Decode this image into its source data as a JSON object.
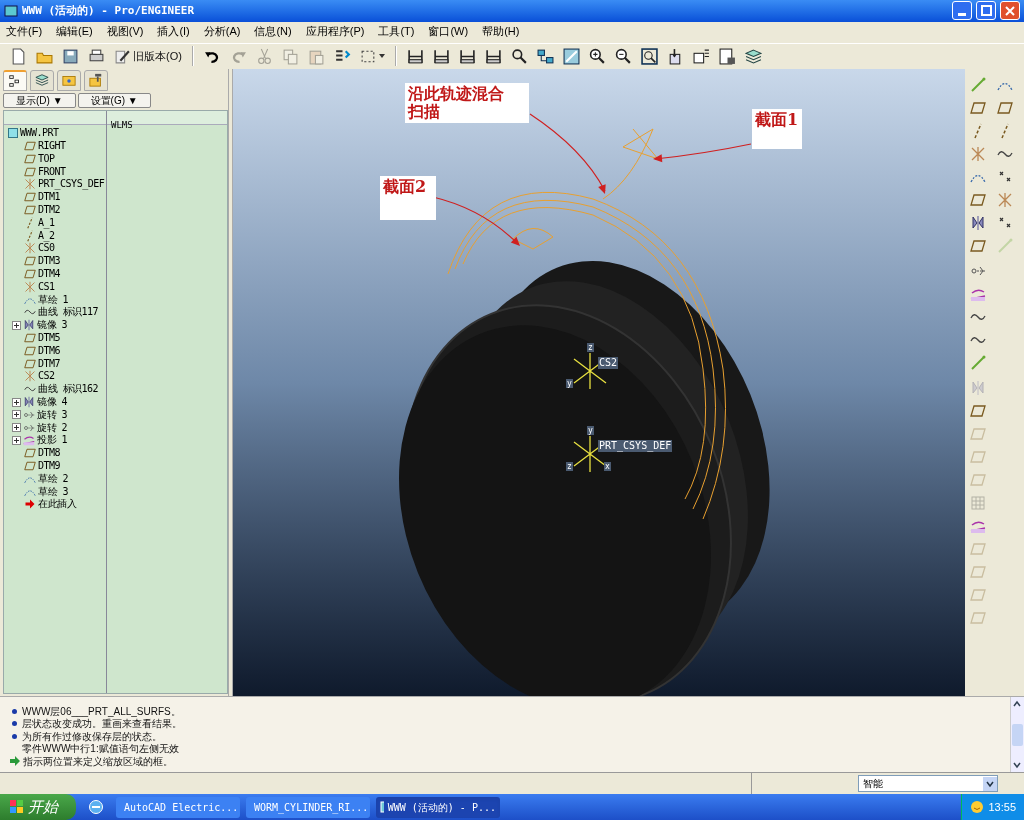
{
  "window": {
    "title": "WWW (活动的) - Pro/ENGINEER"
  },
  "menu": [
    "文件(F)",
    "编辑(E)",
    "视图(V)",
    "插入(I)",
    "分析(A)",
    "信息(N)",
    "应用程序(P)",
    "工具(T)",
    "窗口(W)",
    "帮助(H)"
  ],
  "toolbar": [
    {
      "kind": "new",
      "disabled": false
    },
    {
      "kind": "open",
      "disabled": false
    },
    {
      "kind": "save",
      "disabled": false
    },
    {
      "kind": "print",
      "disabled": false
    },
    {
      "kind": "legacy",
      "disabled": false,
      "label": "旧版本(O)"
    },
    {
      "kind": "sep"
    },
    {
      "kind": "undo",
      "disabled": false
    },
    {
      "kind": "redo",
      "disabled": true
    },
    {
      "kind": "cut",
      "disabled": true
    },
    {
      "kind": "copy",
      "disabled": true
    },
    {
      "kind": "paste",
      "disabled": true
    },
    {
      "kind": "regen",
      "disabled": false
    },
    {
      "kind": "select",
      "disabled": false
    },
    {
      "kind": "sep"
    },
    {
      "kind": "ruler",
      "disabled": false
    },
    {
      "kind": "ruler",
      "disabled": false
    },
    {
      "kind": "ruler",
      "disabled": false
    },
    {
      "kind": "ruler",
      "disabled": false
    },
    {
      "kind": "search",
      "disabled": false
    },
    {
      "kind": "network",
      "disabled": false
    },
    {
      "kind": "shade",
      "disabled": false
    },
    {
      "kind": "zoomin",
      "disabled": false
    },
    {
      "kind": "zoomout",
      "disabled": false
    },
    {
      "kind": "fit",
      "disabled": false
    },
    {
      "kind": "orient",
      "disabled": false
    },
    {
      "kind": "views",
      "disabled": false
    },
    {
      "kind": "sheet",
      "disabled": false
    },
    {
      "kind": "layers",
      "disabled": false
    }
  ],
  "navigator": {
    "tabs": [
      {
        "kind": "tree",
        "selected": true
      },
      {
        "kind": "layers",
        "selected": false
      },
      {
        "kind": "folder",
        "selected": false
      },
      {
        "kind": "favorites",
        "selected": false
      }
    ],
    "buttons": [
      "显示(D) ▼",
      "设置(G) ▼"
    ],
    "column_2": "WLMS",
    "tree": {
      "label": "WWW.PRT",
      "children": [
        {
          "label": "RIGHT",
          "kind": "plane",
          "expander": false
        },
        {
          "label": "TOP",
          "kind": "plane",
          "expander": false
        },
        {
          "label": "FRONT",
          "kind": "plane",
          "expander": false
        },
        {
          "label": "PRT_CSYS_DEF",
          "kind": "csys",
          "expander": false
        },
        {
          "label": "DTM1",
          "kind": "plane",
          "expander": false
        },
        {
          "label": "DTM2",
          "kind": "plane",
          "expander": false
        },
        {
          "label": "A_1",
          "kind": "axis",
          "expander": false
        },
        {
          "label": "A_2",
          "kind": "axis",
          "expander": false
        },
        {
          "label": "CS0",
          "kind": "csys",
          "expander": false
        },
        {
          "label": "DTM3",
          "kind": "plane",
          "expander": false
        },
        {
          "label": "DTM4",
          "kind": "plane",
          "expander": false
        },
        {
          "label": "CS1",
          "kind": "csys",
          "expander": false
        },
        {
          "label": "草绘 1",
          "kind": "sketch",
          "expander": false
        },
        {
          "label": "曲线 标识117",
          "kind": "curve",
          "expander": false
        },
        {
          "label": "镜像 3",
          "kind": "mirror",
          "expander": true
        },
        {
          "label": "DTM5",
          "kind": "plane",
          "expander": false
        },
        {
          "label": "DTM6",
          "kind": "plane",
          "expander": false
        },
        {
          "label": "DTM7",
          "kind": "plane",
          "expander": false
        },
        {
          "label": "CS2",
          "kind": "csys",
          "expander": false
        },
        {
          "label": "曲线 标识162",
          "kind": "curve",
          "expander": false
        },
        {
          "label": "镜像 4",
          "kind": "mirror",
          "expander": true
        },
        {
          "label": "旋转 3",
          "kind": "revolve",
          "expander": true
        },
        {
          "label": "旋转 2",
          "kind": "revolve",
          "expander": true
        },
        {
          "label": "投影 1",
          "kind": "project",
          "expander": true
        },
        {
          "label": "DTM8",
          "kind": "plane",
          "expander": false
        },
        {
          "label": "DTM9",
          "kind": "plane",
          "expander": false
        },
        {
          "label": "草绘 2",
          "kind": "sketch",
          "expander": false
        },
        {
          "label": "草绘 3",
          "kind": "sketch",
          "expander": false
        },
        {
          "label": "在此插入",
          "kind": "insert",
          "expander": false
        }
      ]
    }
  },
  "viewport": {
    "annotations": [
      {
        "lines": [
          "沿此轨迹混合",
          "扫描"
        ]
      },
      {
        "lines": [
          "截面1"
        ]
      },
      {
        "lines": [
          "截面2"
        ]
      }
    ],
    "csys": [
      {
        "label": "CS2",
        "axes": [
          "z",
          "y"
        ]
      },
      {
        "label": "PRT_CSYS_DEF",
        "axes": [
          "y",
          "z",
          "x"
        ]
      }
    ]
  },
  "right_toolbar": {
    "groups": [
      {
        "tools": [
          {
            "kind": "line",
            "disabled": false
          },
          {
            "kind": "sketch",
            "disabled": false
          },
          {
            "kind": "plane",
            "disabled": false
          },
          {
            "kind": "plane",
            "disabled": false
          },
          {
            "kind": "axis",
            "disabled": false
          },
          {
            "kind": "axis",
            "disabled": false
          },
          {
            "kind": "csys",
            "disabled": false
          },
          {
            "kind": "curve",
            "disabled": false
          },
          {
            "kind": "sketch",
            "disabled": false
          },
          {
            "kind": "point",
            "disabled": false
          },
          {
            "kind": "plane",
            "disabled": false
          },
          {
            "kind": "csys",
            "disabled": false
          },
          {
            "kind": "mirror",
            "disabled": false
          },
          {
            "kind": "point",
            "disabled": false
          },
          {
            "kind": "plane",
            "disabled": false
          },
          {
            "kind": "line",
            "disabled": true
          }
        ]
      },
      {
        "tools": [
          {
            "kind": "revolve",
            "disabled": false
          },
          {
            "kind": "project",
            "disabled": false
          },
          {
            "kind": "curve",
            "disabled": false
          },
          {
            "kind": "curve",
            "disabled": false
          },
          {
            "kind": "line",
            "disabled": false
          }
        ]
      },
      {
        "tools": [
          {
            "kind": "mirror",
            "disabled": true
          },
          {
            "kind": "plane",
            "disabled": false
          },
          {
            "kind": "plane",
            "disabled": true
          },
          {
            "kind": "plane",
            "disabled": true
          },
          {
            "kind": "plane",
            "disabled": true
          },
          {
            "kind": "grid",
            "disabled": true
          },
          {
            "kind": "project",
            "disabled": false
          },
          {
            "kind": "plane",
            "disabled": true
          },
          {
            "kind": "plane",
            "disabled": true
          },
          {
            "kind": "plane",
            "disabled": true
          },
          {
            "kind": "plane",
            "disabled": true
          }
        ]
      }
    ]
  },
  "messages": [
    {
      "kind": "info",
      "text": "WWW层06___PRT_ALL_SURFS。"
    },
    {
      "kind": "info",
      "text": "层状态改变成功。重画来查看结果。"
    },
    {
      "kind": "info",
      "text": "为所有作过修改保存层的状态。"
    },
    {
      "kind": "plain",
      "text": "零件WWW中行1:赋值语句左侧无效"
    },
    {
      "kind": "prompt",
      "text": "指示两位置来定义缩放区域的框。"
    }
  ],
  "status_bar": {
    "filter": "智能"
  },
  "taskbar": {
    "start": "开始",
    "tasks": [
      {
        "label": "AutoCAD Electric...",
        "selected": false
      },
      {
        "label": "WORM_CYLINDER_RI...",
        "selected": false
      },
      {
        "label": "WWW (活动的) - P...",
        "selected": true
      }
    ],
    "clock": "13:55"
  }
}
